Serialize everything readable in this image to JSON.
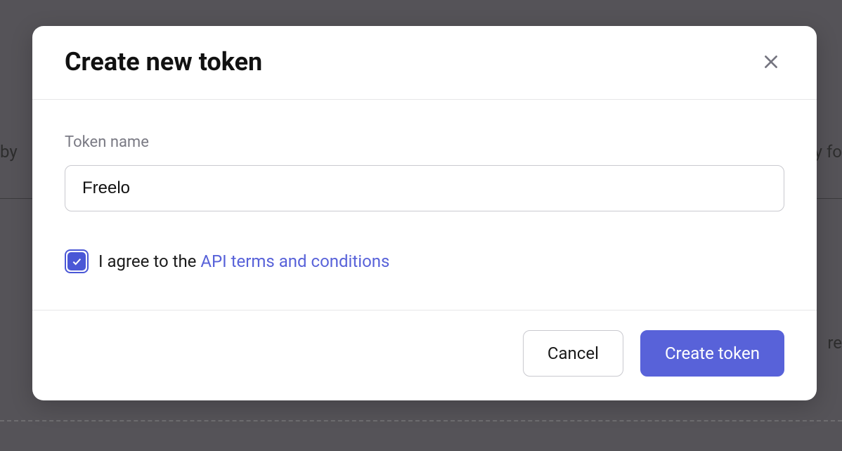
{
  "backdrop": {
    "left_text": "by",
    "right_text": "y fo",
    "right_text2": "re"
  },
  "modal": {
    "title": "Create new token",
    "token_name_label": "Token name",
    "token_name_value": "Freelo",
    "agree_prefix": "I agree to the ",
    "agree_link": "API terms and conditions",
    "checkbox_checked": true,
    "cancel_label": "Cancel",
    "create_label": "Create token"
  }
}
